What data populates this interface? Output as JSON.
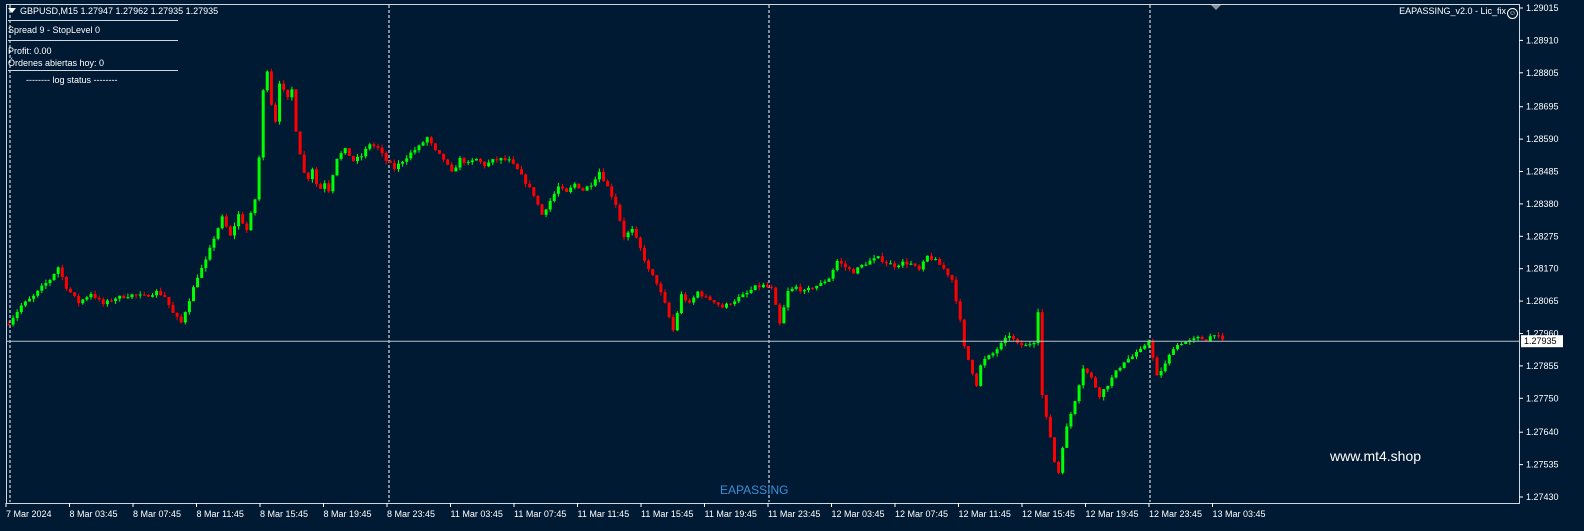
{
  "symbol_header": "GBPUSD,M15  1.27947 1.27962 1.27935 1.27935",
  "info_panel": {
    "spread_line": "Spread 9 - StopLevel 0",
    "profit_line": "Profit: 0.00",
    "orders_line": "Órdenes abiertas hoy: 0",
    "log_status": "-------- log status --------"
  },
  "ea_label": "EAPASSING_v2.0 - Lic_fix",
  "smiley_icon": "smiley-icon",
  "watermark": "www.mt4.shop",
  "ea_name": "EAPASSING",
  "colors": {
    "background": "#001a33",
    "bull": "#00ff00",
    "bear": "#ff0000",
    "grid": "#ffffff",
    "axis_text": "#ffffff",
    "current_price_line": "#b8c2cc",
    "ea_name": "#3a8fd9"
  },
  "chart_data": {
    "type": "candlestick",
    "symbol": "GBPUSD",
    "timeframe": "M15",
    "current_price": 1.27935,
    "current_price_label": "1.27935",
    "ylim": [
      1.2743,
      1.29015
    ],
    "price_ticks": [
      "1.29015",
      "1.28910",
      "1.28805",
      "1.28695",
      "1.28590",
      "1.28485",
      "1.28380",
      "1.28275",
      "1.28170",
      "1.28065",
      "1.27960",
      "1.27855",
      "1.27750",
      "1.27640",
      "1.27535",
      "1.27430"
    ],
    "time_ticks": [
      "7 Mar 2024",
      "8 Mar 03:45",
      "8 Mar 07:45",
      "8 Mar 11:45",
      "8 Mar 15:45",
      "8 Mar 19:45",
      "8 Mar 23:45",
      "11 Mar 03:45",
      "11 Mar 07:45",
      "11 Mar 11:45",
      "11 Mar 15:45",
      "11 Mar 19:45",
      "11 Mar 23:45",
      "12 Mar 03:45",
      "12 Mar 07:45",
      "12 Mar 11:45",
      "12 Mar 15:45",
      "12 Mar 19:45",
      "12 Mar 23:45",
      "13 Mar 03:45"
    ],
    "day_separators": [
      "8 Mar 00:00",
      "11 Mar 00:00",
      "12 Mar 00:00",
      "13 Mar 00:00"
    ],
    "close_path": [
      [
        0,
        1.27995
      ],
      [
        3,
        1.2805
      ],
      [
        6,
        1.2808
      ],
      [
        8,
        1.2811
      ],
      [
        10,
        1.28135
      ],
      [
        12,
        1.28175
      ],
      [
        14,
        1.2811
      ],
      [
        17,
        1.2806
      ],
      [
        20,
        1.2809
      ],
      [
        23,
        1.28055
      ],
      [
        26,
        1.28075
      ],
      [
        30,
        1.28085
      ],
      [
        33,
        1.2808
      ],
      [
        36,
        1.28095
      ],
      [
        38,
        1.2808
      ],
      [
        40,
        1.28025
      ],
      [
        42,
        1.27995
      ],
      [
        44,
        1.2807
      ],
      [
        46,
        1.28145
      ],
      [
        48,
        1.28195
      ],
      [
        50,
        1.2827
      ],
      [
        52,
        1.28335
      ],
      [
        54,
        1.28275
      ],
      [
        56,
        1.28345
      ],
      [
        58,
        1.28295
      ],
      [
        59,
        1.28345
      ],
      [
        60,
        1.28395
      ],
      [
        61,
        1.2853
      ],
      [
        62,
        1.28745
      ],
      [
        63,
        1.28815
      ],
      [
        64,
        1.28705
      ],
      [
        65,
        1.2865
      ],
      [
        66,
        1.28775
      ],
      [
        67,
        1.28745
      ],
      [
        68,
        1.2872
      ],
      [
        69,
        1.2875
      ],
      [
        70,
        1.2862
      ],
      [
        71,
        1.28545
      ],
      [
        72,
        1.2848
      ],
      [
        73,
        1.28465
      ],
      [
        74,
        1.28495
      ],
      [
        75,
        1.28445
      ],
      [
        76,
        1.2843
      ],
      [
        77,
        1.2845
      ],
      [
        78,
        1.28425
      ],
      [
        80,
        1.2853
      ],
      [
        82,
        1.28555
      ],
      [
        84,
        1.2852
      ],
      [
        86,
        1.28535
      ],
      [
        88,
        1.28575
      ],
      [
        90,
        1.2856
      ],
      [
        92,
        1.2852
      ],
      [
        94,
        1.28495
      ],
      [
        96,
        1.2852
      ],
      [
        98,
        1.28545
      ],
      [
        100,
        1.28565
      ],
      [
        102,
        1.28595
      ],
      [
        104,
        1.2855
      ],
      [
        106,
        1.28525
      ],
      [
        108,
        1.2848
      ],
      [
        110,
        1.28525
      ],
      [
        112,
        1.2851
      ],
      [
        114,
        1.28525
      ],
      [
        116,
        1.28505
      ],
      [
        118,
        1.2852
      ],
      [
        120,
        1.28525
      ],
      [
        122,
        1.2852
      ],
      [
        124,
        1.2849
      ],
      [
        126,
        1.2845
      ],
      [
        128,
        1.2841
      ],
      [
        130,
        1.28345
      ],
      [
        132,
        1.2839
      ],
      [
        134,
        1.28435
      ],
      [
        136,
        1.28415
      ],
      [
        138,
        1.28445
      ],
      [
        140,
        1.28425
      ],
      [
        142,
        1.28445
      ],
      [
        144,
        1.28485
      ],
      [
        146,
        1.28435
      ],
      [
        148,
        1.2838
      ],
      [
        150,
        1.28275
      ],
      [
        152,
        1.28295
      ],
      [
        154,
        1.28235
      ],
      [
        156,
        1.28165
      ],
      [
        158,
        1.28125
      ],
      [
        160,
        1.28055
      ],
      [
        162,
        1.2797
      ],
      [
        164,
        1.28085
      ],
      [
        166,
        1.28055
      ],
      [
        168,
        1.28095
      ],
      [
        170,
        1.28075
      ],
      [
        172,
        1.28065
      ],
      [
        174,
        1.28045
      ],
      [
        176,
        1.2806
      ],
      [
        178,
        1.28075
      ],
      [
        180,
        1.2809
      ],
      [
        182,
        1.2811
      ],
      [
        184,
        1.28115
      ],
      [
        186,
        1.28105
      ],
      [
        188,
        1.2799
      ],
      [
        190,
        1.28095
      ],
      [
        192,
        1.2811
      ],
      [
        194,
        1.28095
      ],
      [
        196,
        1.2811
      ],
      [
        198,
        1.2812
      ],
      [
        200,
        1.2814
      ],
      [
        202,
        1.28195
      ],
      [
        204,
        1.28175
      ],
      [
        206,
        1.2816
      ],
      [
        208,
        1.2818
      ],
      [
        210,
        1.28195
      ],
      [
        212,
        1.28205
      ],
      [
        214,
        1.2819
      ],
      [
        216,
        1.2818
      ],
      [
        218,
        1.2819
      ],
      [
        220,
        1.28185
      ],
      [
        222,
        1.28165
      ],
      [
        224,
        1.2821
      ],
      [
        226,
        1.28195
      ],
      [
        228,
        1.2817
      ],
      [
        230,
        1.28135
      ],
      [
        231,
        1.2807
      ],
      [
        232,
        1.28
      ],
      [
        233,
        1.27915
      ],
      [
        234,
        1.27875
      ],
      [
        235,
        1.27835
      ],
      [
        236,
        1.27795
      ],
      [
        237,
        1.27855
      ],
      [
        238,
        1.27875
      ],
      [
        240,
        1.27895
      ],
      [
        242,
        1.27925
      ],
      [
        244,
        1.27955
      ],
      [
        246,
        1.27925
      ],
      [
        248,
        1.2792
      ],
      [
        250,
        1.27935
      ],
      [
        251,
        1.28035
      ],
      [
        252,
        1.2776
      ],
      [
        253,
        1.27685
      ],
      [
        254,
        1.27625
      ],
      [
        255,
        1.27545
      ],
      [
        256,
        1.2751
      ],
      [
        257,
        1.27595
      ],
      [
        258,
        1.27655
      ],
      [
        260,
        1.27745
      ],
      [
        262,
        1.2785
      ],
      [
        264,
        1.27815
      ],
      [
        266,
        1.2776
      ],
      [
        268,
        1.27795
      ],
      [
        270,
        1.27835
      ],
      [
        272,
        1.2787
      ],
      [
        274,
        1.27885
      ],
      [
        276,
        1.27905
      ],
      [
        278,
        1.2794
      ],
      [
        279,
        1.2788
      ],
      [
        280,
        1.2782
      ],
      [
        282,
        1.2786
      ],
      [
        284,
        1.27915
      ],
      [
        286,
        1.2793
      ],
      [
        288,
        1.27935
      ],
      [
        290,
        1.27945
      ],
      [
        292,
        1.2794
      ],
      [
        294,
        1.2796
      ],
      [
        296,
        1.27935
      ]
    ]
  }
}
